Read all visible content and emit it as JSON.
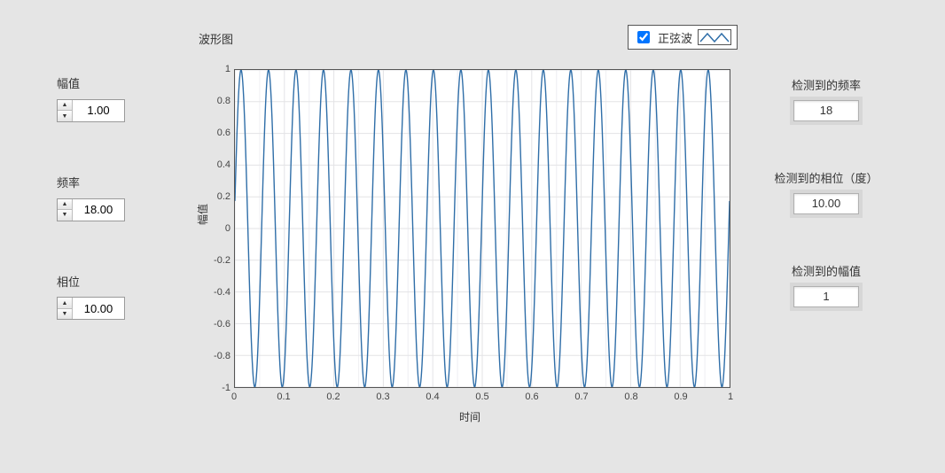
{
  "inputs": {
    "amplitude": {
      "label": "幅值",
      "value": "1.00"
    },
    "frequency": {
      "label": "频率",
      "value": "18.00"
    },
    "phase": {
      "label": "相位",
      "value": "10.00"
    }
  },
  "outputs": {
    "det_freq": {
      "label": "检测到的频率",
      "value": "18"
    },
    "det_phase": {
      "label": "检测到的相位（度）",
      "value": "10.00"
    },
    "det_amp": {
      "label": "检测到的幅值",
      "value": "1"
    }
  },
  "chart": {
    "title": "波形图",
    "legend": {
      "checked": true,
      "label": "正弦波"
    },
    "xlabel": "时间",
    "ylabel": "幅值",
    "xticks": [
      "0",
      "0.1",
      "0.2",
      "0.3",
      "0.4",
      "0.5",
      "0.6",
      "0.7",
      "0.8",
      "0.9",
      "1"
    ],
    "yticks": [
      "1",
      "0.8",
      "0.6",
      "0.4",
      "0.2",
      "0",
      "-0.2",
      "-0.4",
      "-0.6",
      "-0.8",
      "-1"
    ]
  },
  "chart_data": {
    "type": "line",
    "title": "波形图",
    "xlabel": "时间",
    "ylabel": "幅值",
    "xlim": [
      0,
      1
    ],
    "ylim": [
      -1,
      1
    ],
    "legend_position": "top-right",
    "grid": true,
    "series": [
      {
        "name": "正弦波",
        "kind": "sine",
        "amplitude": 1.0,
        "frequency_hz": 18.0,
        "phase_deg": 10.0,
        "color": "#2f6ea8",
        "note": "y = amplitude * sin(2π·frequency_hz·t + phase_deg·π/180), t ∈ [0,1]; ≈18 full cycles across the x-range"
      }
    ],
    "xtick_values": [
      0,
      0.1,
      0.2,
      0.3,
      0.4,
      0.5,
      0.6,
      0.7,
      0.8,
      0.9,
      1
    ],
    "ytick_values": [
      -1,
      -0.8,
      -0.6,
      -0.4,
      -0.2,
      0,
      0.2,
      0.4,
      0.6,
      0.8,
      1
    ]
  }
}
